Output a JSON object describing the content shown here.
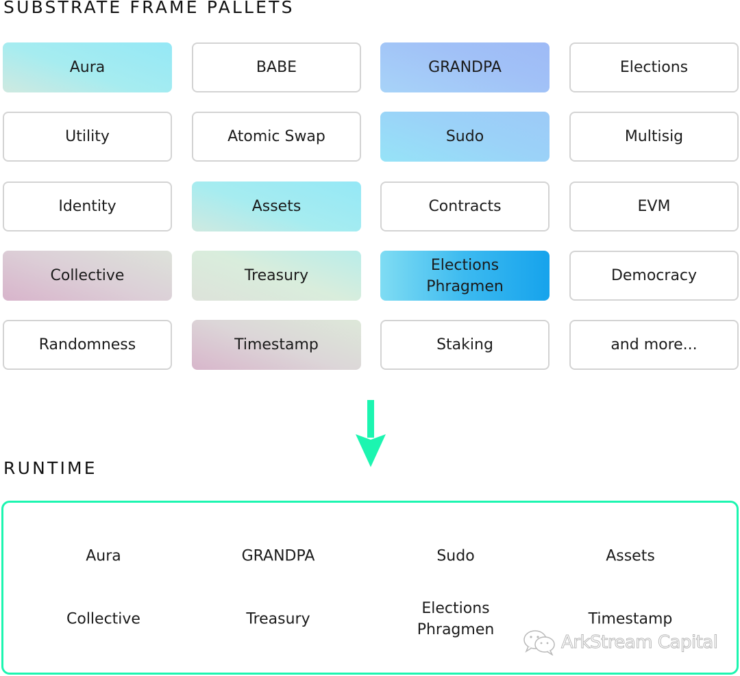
{
  "pallets_section": {
    "title": "SUBSTRATE FRAME PALLETS",
    "cards": [
      {
        "label": "Aura",
        "style": "g-cyan",
        "row": 0,
        "col": 0
      },
      {
        "label": "BABE",
        "style": "outline",
        "row": 0,
        "col": 1
      },
      {
        "label": "GRANDPA",
        "style": "g-blue",
        "row": 0,
        "col": 2
      },
      {
        "label": "Elections",
        "style": "outline",
        "row": 0,
        "col": 3
      },
      {
        "label": "Utility",
        "style": "outline",
        "row": 1,
        "col": 0
      },
      {
        "label": "Atomic Swap",
        "style": "outline",
        "row": 1,
        "col": 1
      },
      {
        "label": "Sudo",
        "style": "g-sky",
        "row": 1,
        "col": 2
      },
      {
        "label": "Multisig",
        "style": "outline",
        "row": 1,
        "col": 3
      },
      {
        "label": "Identity",
        "style": "outline",
        "row": 2,
        "col": 0
      },
      {
        "label": "Assets",
        "style": "g-cyan",
        "row": 2,
        "col": 1
      },
      {
        "label": "Contracts",
        "style": "outline",
        "row": 2,
        "col": 2
      },
      {
        "label": "EVM",
        "style": "outline",
        "row": 2,
        "col": 3
      },
      {
        "label": "Collective",
        "style": "g-pink",
        "row": 3,
        "col": 0
      },
      {
        "label": "Treasury",
        "style": "g-mint",
        "row": 3,
        "col": 1
      },
      {
        "label": "Elections\nPhragmen",
        "style": "g-deep",
        "row": 3,
        "col": 2
      },
      {
        "label": "Democracy",
        "style": "outline",
        "row": 3,
        "col": 3
      },
      {
        "label": "Randomness",
        "style": "outline",
        "row": 4,
        "col": 0
      },
      {
        "label": "Timestamp",
        "style": "g-pinkmint",
        "row": 4,
        "col": 1
      },
      {
        "label": "Staking",
        "style": "outline",
        "row": 4,
        "col": 2
      },
      {
        "label": "and more...",
        "style": "outline",
        "row": 4,
        "col": 3
      }
    ]
  },
  "arrow": {
    "icon": "arrow-down-icon",
    "color": "#1cf5b0"
  },
  "runtime_section": {
    "title": "RUNTIME",
    "border_color": "#1cf5b0",
    "items": [
      {
        "label": "Aura",
        "row": 0,
        "col": 0
      },
      {
        "label": "GRANDPA",
        "row": 0,
        "col": 1
      },
      {
        "label": "Sudo",
        "row": 0,
        "col": 2
      },
      {
        "label": "Assets",
        "row": 0,
        "col": 3
      },
      {
        "label": "Collective",
        "row": 1,
        "col": 0
      },
      {
        "label": "Treasury",
        "row": 1,
        "col": 1
      },
      {
        "label": "Elections\nPhragmen",
        "row": 1,
        "col": 2
      },
      {
        "label": "Timestamp",
        "row": 1,
        "col": 3
      }
    ]
  },
  "watermark": {
    "icon": "wechat-icon",
    "text": "ArkStream Capital"
  }
}
